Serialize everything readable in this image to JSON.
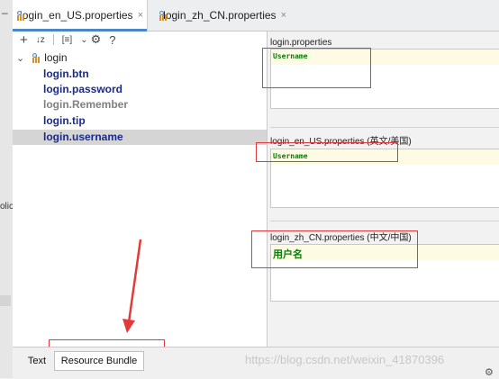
{
  "gutter": {
    "collapse_glyph": "–",
    "partial_text": "olic"
  },
  "tabs": [
    {
      "label": "login_en_US.properties",
      "icon": "properties-file-icon",
      "close": "×",
      "active": true
    },
    {
      "label": "login_zh_CN.properties",
      "icon": "properties-file-icon",
      "close": "×",
      "active": false
    }
  ],
  "toolbar": {
    "add": "+",
    "sort": "↓z",
    "group": "[≡]",
    "dropdown": "⌄",
    "settings": "⚙",
    "help": "?"
  },
  "tree": {
    "expander": "⌄",
    "root": "login",
    "items": [
      {
        "label": "login.btn",
        "style": "blue"
      },
      {
        "label": "login.password",
        "style": "blue"
      },
      {
        "label": "login.Remember",
        "style": "gray"
      },
      {
        "label": "login.tip",
        "style": "blue"
      },
      {
        "label": "login.username",
        "style": "blue",
        "selected": true
      }
    ]
  },
  "editors": [
    {
      "label": "login.properties",
      "value": "Username"
    },
    {
      "label": "login_en_US.properties (英文/美国)",
      "value": "Username"
    },
    {
      "label": "login_zh_CN.properties (中文/中国)",
      "value": "用户名"
    }
  ],
  "bottom_tabs": [
    {
      "label": "Text",
      "active": false
    },
    {
      "label": "Resource Bundle",
      "active": true
    }
  ],
  "watermark": "https://blog.csdn.net/weixin_41870396",
  "colors": {
    "annotation_red": "#e23a3a",
    "value_green": "#0b7a0b",
    "key_blue": "#1a2a8a",
    "tab_accent": "#4a86c8"
  }
}
